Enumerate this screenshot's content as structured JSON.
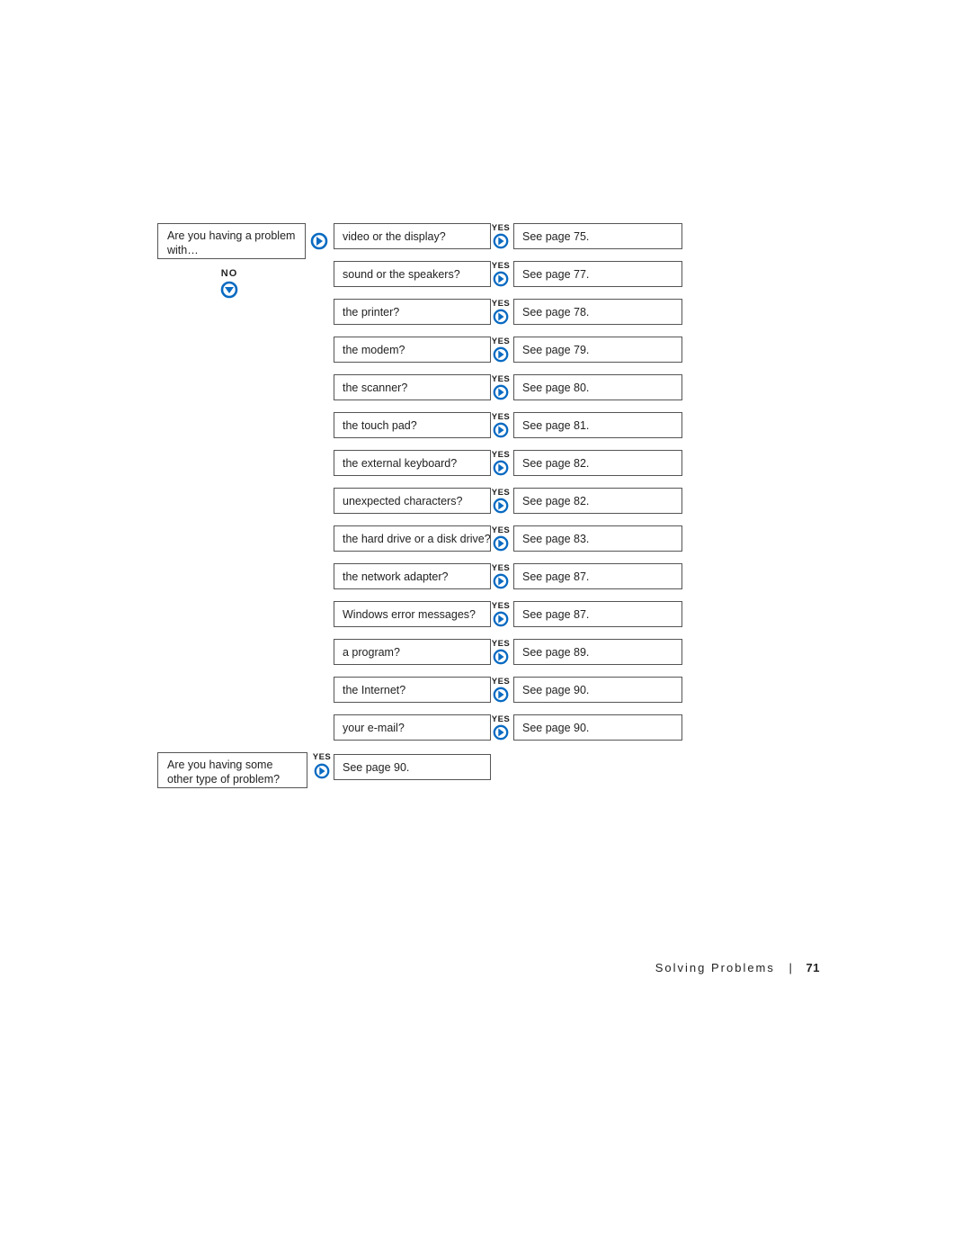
{
  "icons": {
    "arrow_right_color": "#0a6bc2",
    "arrow_down_color": "#0a6bc2"
  },
  "question1": "Are you having a problem with…",
  "no_label": "NO",
  "yes_label": "YES",
  "rows": [
    {
      "q": "video or the display?",
      "a": "See page 75."
    },
    {
      "q": "sound or the speakers?",
      "a": "See page 77."
    },
    {
      "q": "the printer?",
      "a": "See page 78."
    },
    {
      "q": "the modem?",
      "a": "See page 79."
    },
    {
      "q": "the scanner?",
      "a": "See page 80."
    },
    {
      "q": "the touch pad?",
      "a": "See page 81."
    },
    {
      "q": "the external keyboard?",
      "a": "See page 82."
    },
    {
      "q": "unexpected characters?",
      "a": "See page 82."
    },
    {
      "q": "the hard drive or a disk drive?",
      "a": "See page 83."
    },
    {
      "q": "the network adapter?",
      "a": "See page 87."
    },
    {
      "q": "Windows error messages?",
      "a": "See page 87."
    },
    {
      "q": "a program?",
      "a": "See page 89."
    },
    {
      "q": "the Internet?",
      "a": "See page 90."
    },
    {
      "q": "your e-mail?",
      "a": "See page 90."
    }
  ],
  "question2": "Are you having some other type of problem?",
  "answer2": "See page 90.",
  "footer": {
    "section": "Solving Problems",
    "page": "71"
  }
}
